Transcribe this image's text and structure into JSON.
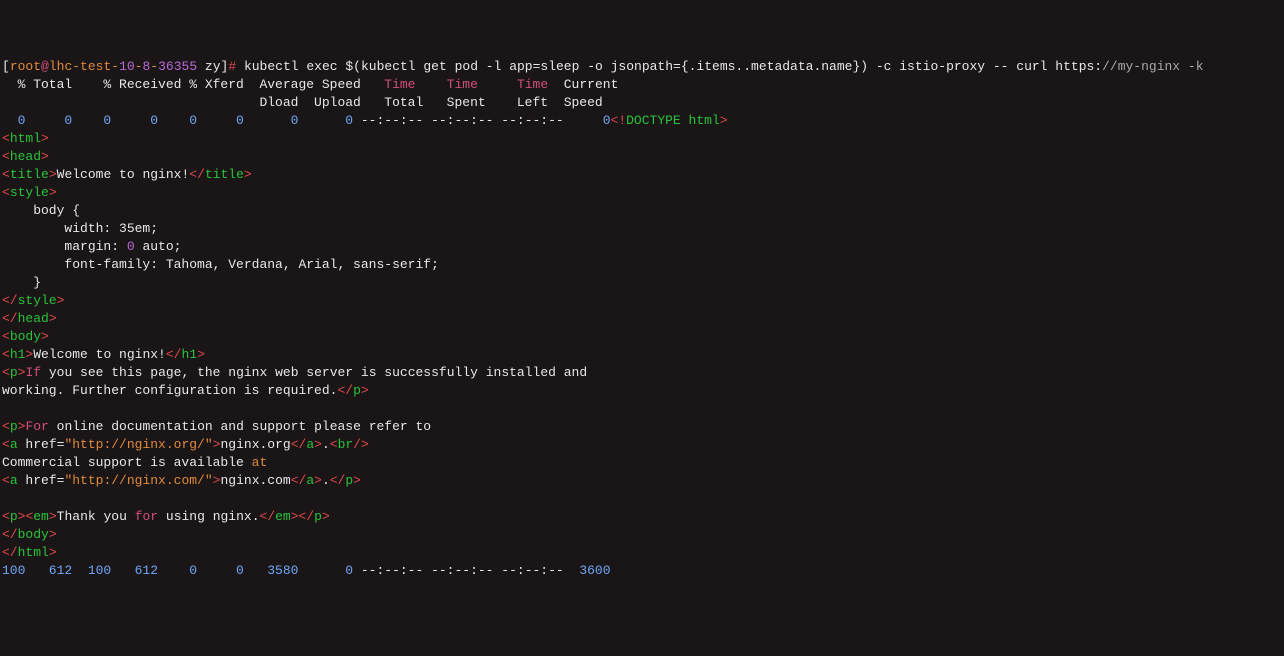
{
  "prompt": {
    "br_open": "[",
    "user": "root",
    "at": "@",
    "host_a": "lhc-test-",
    "host_b": "10",
    "host_c": "-",
    "host_d": "8",
    "host_e": "-",
    "host_f": "36355",
    "dir": " zy",
    "br_close": "]",
    "hash": "# "
  },
  "command": {
    "p1": "kubectl exec $(kubectl get pod -l app=sleep -o jsonpath={.items..metadata.name}) -c istio-proxy -- curl https:",
    "slashes": "//my-nginx -k"
  },
  "hdr": {
    "l1a": "  % Total    % Received % Xferd  Average Speed   ",
    "l1_time1": "Time",
    "l1_sp1": "    ",
    "l1_time2": "Time",
    "l1_sp2": "     ",
    "l1_time3": "Time",
    "l1b": "  Current",
    "l2": "                                 Dload  Upload   Total   Spent    Left  Speed"
  },
  "row0": {
    "nums": "  0     0    0     0    0     0      0      0",
    "dashes": " --:--:-- --:--:-- --:--:--     ",
    "zero": "0",
    "doctype_open": "<!",
    "doctype_txt": "DOCTYPE html",
    "doctype_close": ">"
  },
  "html_parts": {
    "open_html": {
      "lt": "<",
      "tag": "html",
      "gt": ">"
    },
    "open_head": {
      "lt": "<",
      "tag": "head",
      "gt": ">"
    },
    "open_title": {
      "lt": "<",
      "tag": "title",
      "gt": ">"
    },
    "title_text": "Welcome to nginx!",
    "close_title": {
      "lt": "</",
      "tag": "title",
      "gt": ">"
    },
    "open_style": {
      "lt": "<",
      "tag": "style",
      "gt": ">"
    },
    "style_l1": "    body {",
    "style_l2": "        width: 35em;",
    "style_l3a": "        margin: ",
    "style_l3b": "0",
    "style_l3c": " auto;",
    "style_l4": "        font-family: Tahoma, Verdana, Arial, sans-serif;",
    "style_l5": "    }",
    "close_style": {
      "lt": "</",
      "tag": "style",
      "gt": ">"
    },
    "close_head": {
      "lt": "</",
      "tag": "head",
      "gt": ">"
    },
    "open_body": {
      "lt": "<",
      "tag": "body",
      "gt": ">"
    },
    "open_h1": {
      "lt": "<",
      "tag": "h1",
      "gt": ">"
    },
    "h1_text": "Welcome to nginx!",
    "close_h1": {
      "lt": "</",
      "tag": "h1",
      "gt": ">"
    },
    "open_p1": {
      "lt": "<",
      "tag": "p",
      "gt": ">"
    },
    "p1_if": "If",
    "p1_rest1": " you see this page, the nginx web server is successfully installed and",
    "p1_rest2": "working. Further configuration is required.",
    "close_p1": {
      "lt": "</",
      "tag": "p",
      "gt": ">"
    },
    "open_p2": {
      "lt": "<",
      "tag": "p",
      "gt": ">"
    },
    "p2_for": "For",
    "p2_rest": " online documentation and support please refer to",
    "a1_open_lt": "<",
    "a1_tag": "a",
    "a1_href_attr": " href=",
    "a1_href_val": "\"http://nginx.org/\"",
    "a1_gt": ">",
    "a1_text": "nginx.org",
    "a1_close_lt": "</",
    "a1_close_tag": "a",
    "a1_close_gt": ">",
    "dot1": ".",
    "br_lt": "<",
    "br_tag": "br",
    "br_gt": "/>",
    "comm_support_a": "Commercial support is available ",
    "comm_support_at": "at",
    "a2_open_lt": "<",
    "a2_tag": "a",
    "a2_href_attr": " href=",
    "a2_href_val": "\"http://nginx.com/\"",
    "a2_gt": ">",
    "a2_text": "nginx.com",
    "a2_close_lt": "</",
    "a2_close_tag": "a",
    "a2_close_gt": ">",
    "dot2": ".",
    "close_p2": {
      "lt": "</",
      "tag": "p",
      "gt": ">"
    },
    "open_p3": {
      "lt": "<",
      "tag": "p",
      "gt": ">"
    },
    "open_em": {
      "lt": "<",
      "tag": "em",
      "gt": ">"
    },
    "p3_a": "Thank you ",
    "p3_for": "for",
    "p3_b": " using nginx.",
    "close_em": {
      "lt": "</",
      "tag": "em",
      "gt": ">"
    },
    "close_p3": {
      "lt": "</",
      "tag": "p",
      "gt": ">"
    },
    "close_body": {
      "lt": "</",
      "tag": "body",
      "gt": ">"
    },
    "close_html": {
      "lt": "</",
      "tag": "html",
      "gt": ">"
    }
  },
  "row_end": {
    "nums": "100   612  100   612    0     0   3580      0",
    "dashes": " --:--:-- --:--:-- --:--:--  ",
    "last": "3600"
  }
}
